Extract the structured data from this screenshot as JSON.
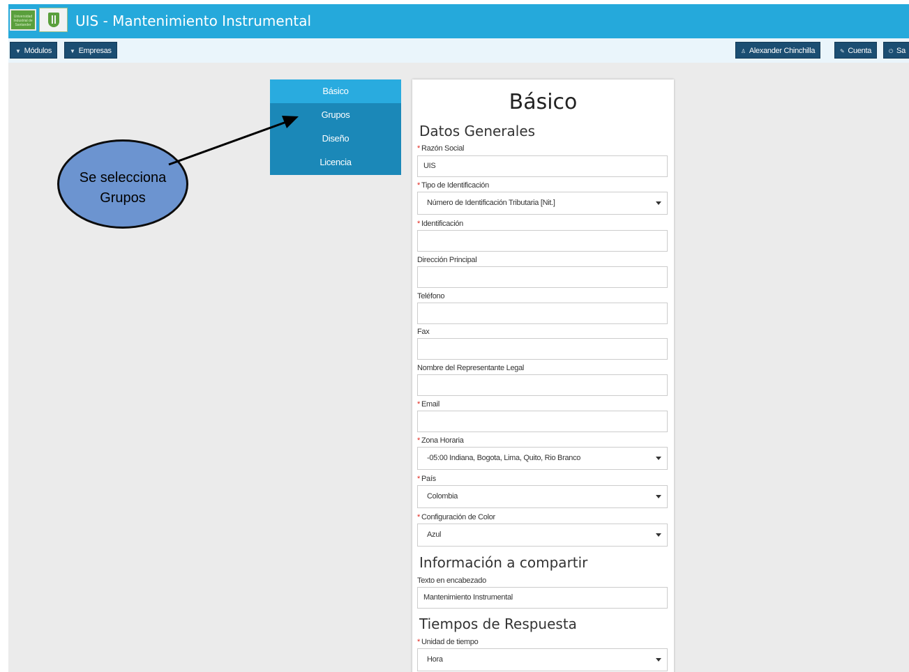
{
  "header": {
    "title": "UIS - Mantenimiento Instrumental",
    "logo_text": "Universidad Industrial de Santander"
  },
  "toolbar": {
    "modulos": "Módulos",
    "empresas": "Empresas",
    "user": "Alexander Chinchilla",
    "cuenta": "Cuenta",
    "salir": "Sa"
  },
  "sidemenu": {
    "items": [
      {
        "label": "Básico",
        "active": true
      },
      {
        "label": "Grupos",
        "active": false
      },
      {
        "label": "Diseño",
        "active": false
      },
      {
        "label": "Licencia",
        "active": false
      }
    ]
  },
  "callout": {
    "line1": "Se selecciona",
    "line2": "Grupos"
  },
  "panel": {
    "title": "Básico",
    "sections": {
      "datos": "Datos Generales",
      "info": "Información a compartir",
      "tiempos": "Tiempos de Respuesta"
    },
    "fields": {
      "razon": {
        "label": "Razón Social",
        "value": "UIS"
      },
      "tipo": {
        "label": "Tipo de Identificación",
        "value": "Número de Identificación Tributaria [Nit.]"
      },
      "ident": {
        "label": "Identificación",
        "value": ""
      },
      "direccion": {
        "label": "Dirección Principal",
        "value": ""
      },
      "telefono": {
        "label": "Teléfono",
        "value": ""
      },
      "fax": {
        "label": "Fax",
        "value": ""
      },
      "representante": {
        "label": "Nombre del Representante Legal",
        "value": ""
      },
      "email": {
        "label": "Email",
        "value": ""
      },
      "zona": {
        "label": "Zona Horaria",
        "value": "-05:00 Indiana, Bogota, Lima, Quito, Rio Branco"
      },
      "pais": {
        "label": "País",
        "value": "Colombia"
      },
      "color": {
        "label": "Configuración de Color",
        "value": "Azul"
      },
      "texto": {
        "label": "Texto en encabezado",
        "value": "Mantenimiento Instrumental"
      },
      "unidad": {
        "label": "Unidad de tiempo",
        "value": "Hora"
      }
    }
  },
  "colors": {
    "header": "#25a9db",
    "toolbar_button": "#1b4e72",
    "menu": "#1b88b8",
    "menu_active": "#29abdf",
    "callout": "#6c94d0",
    "required": "#e0281f"
  }
}
